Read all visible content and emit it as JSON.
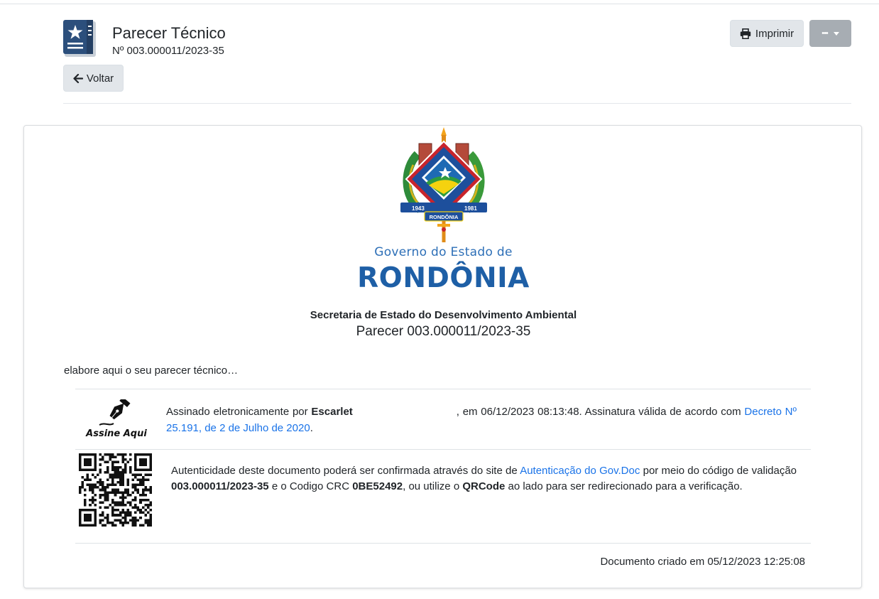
{
  "header": {
    "title": "Parecer Técnico",
    "number": "Nº 003.000011/2023-35",
    "print_label": "Imprimir",
    "more_label": "•••",
    "back_label": "Voltar"
  },
  "document": {
    "gov_line1": "Governo do Estado de",
    "gov_line2": "RONDÔNIA",
    "crest_year_left": "1943",
    "crest_year_right": "1981",
    "crest_banner": "RONDÔNIA",
    "secretaria": "Secretaria de Estado do Desenvolvimento Ambiental",
    "parecer_number": "Parecer 003.000011/2023-35",
    "body": "elabore aqui o seu parecer técnico…"
  },
  "signature": {
    "logo_text": "Assine Aqui",
    "prefix": "Assinado eletronicamente por",
    "name": "Escarlet",
    "date_text": ", em 06/12/2023 08:13:48. Assinatura válida de acordo com",
    "link_text": "Decreto Nº 25.191, de 2 de Julho de 2020",
    "suffix": "."
  },
  "authenticity": {
    "part1": "Autenticidade deste documento poderá ser confirmada através do site de",
    "link_text": "Autenticação do Gov.Doc",
    "part2": "por meio do código de validação",
    "code": "003.000011/2023-35",
    "part3": "e o Codigo CRC",
    "crc": "0BE52492",
    "part4": ", ou utilize o",
    "qrcode_label": "QRCode",
    "part5": "ao lado para ser redirecionado para a verificação."
  },
  "footer": {
    "created": "Documento criado em 05/12/2023 12:25:08"
  },
  "colors": {
    "link": "#1a73e8",
    "brand_blue": "#1e5fa6"
  }
}
